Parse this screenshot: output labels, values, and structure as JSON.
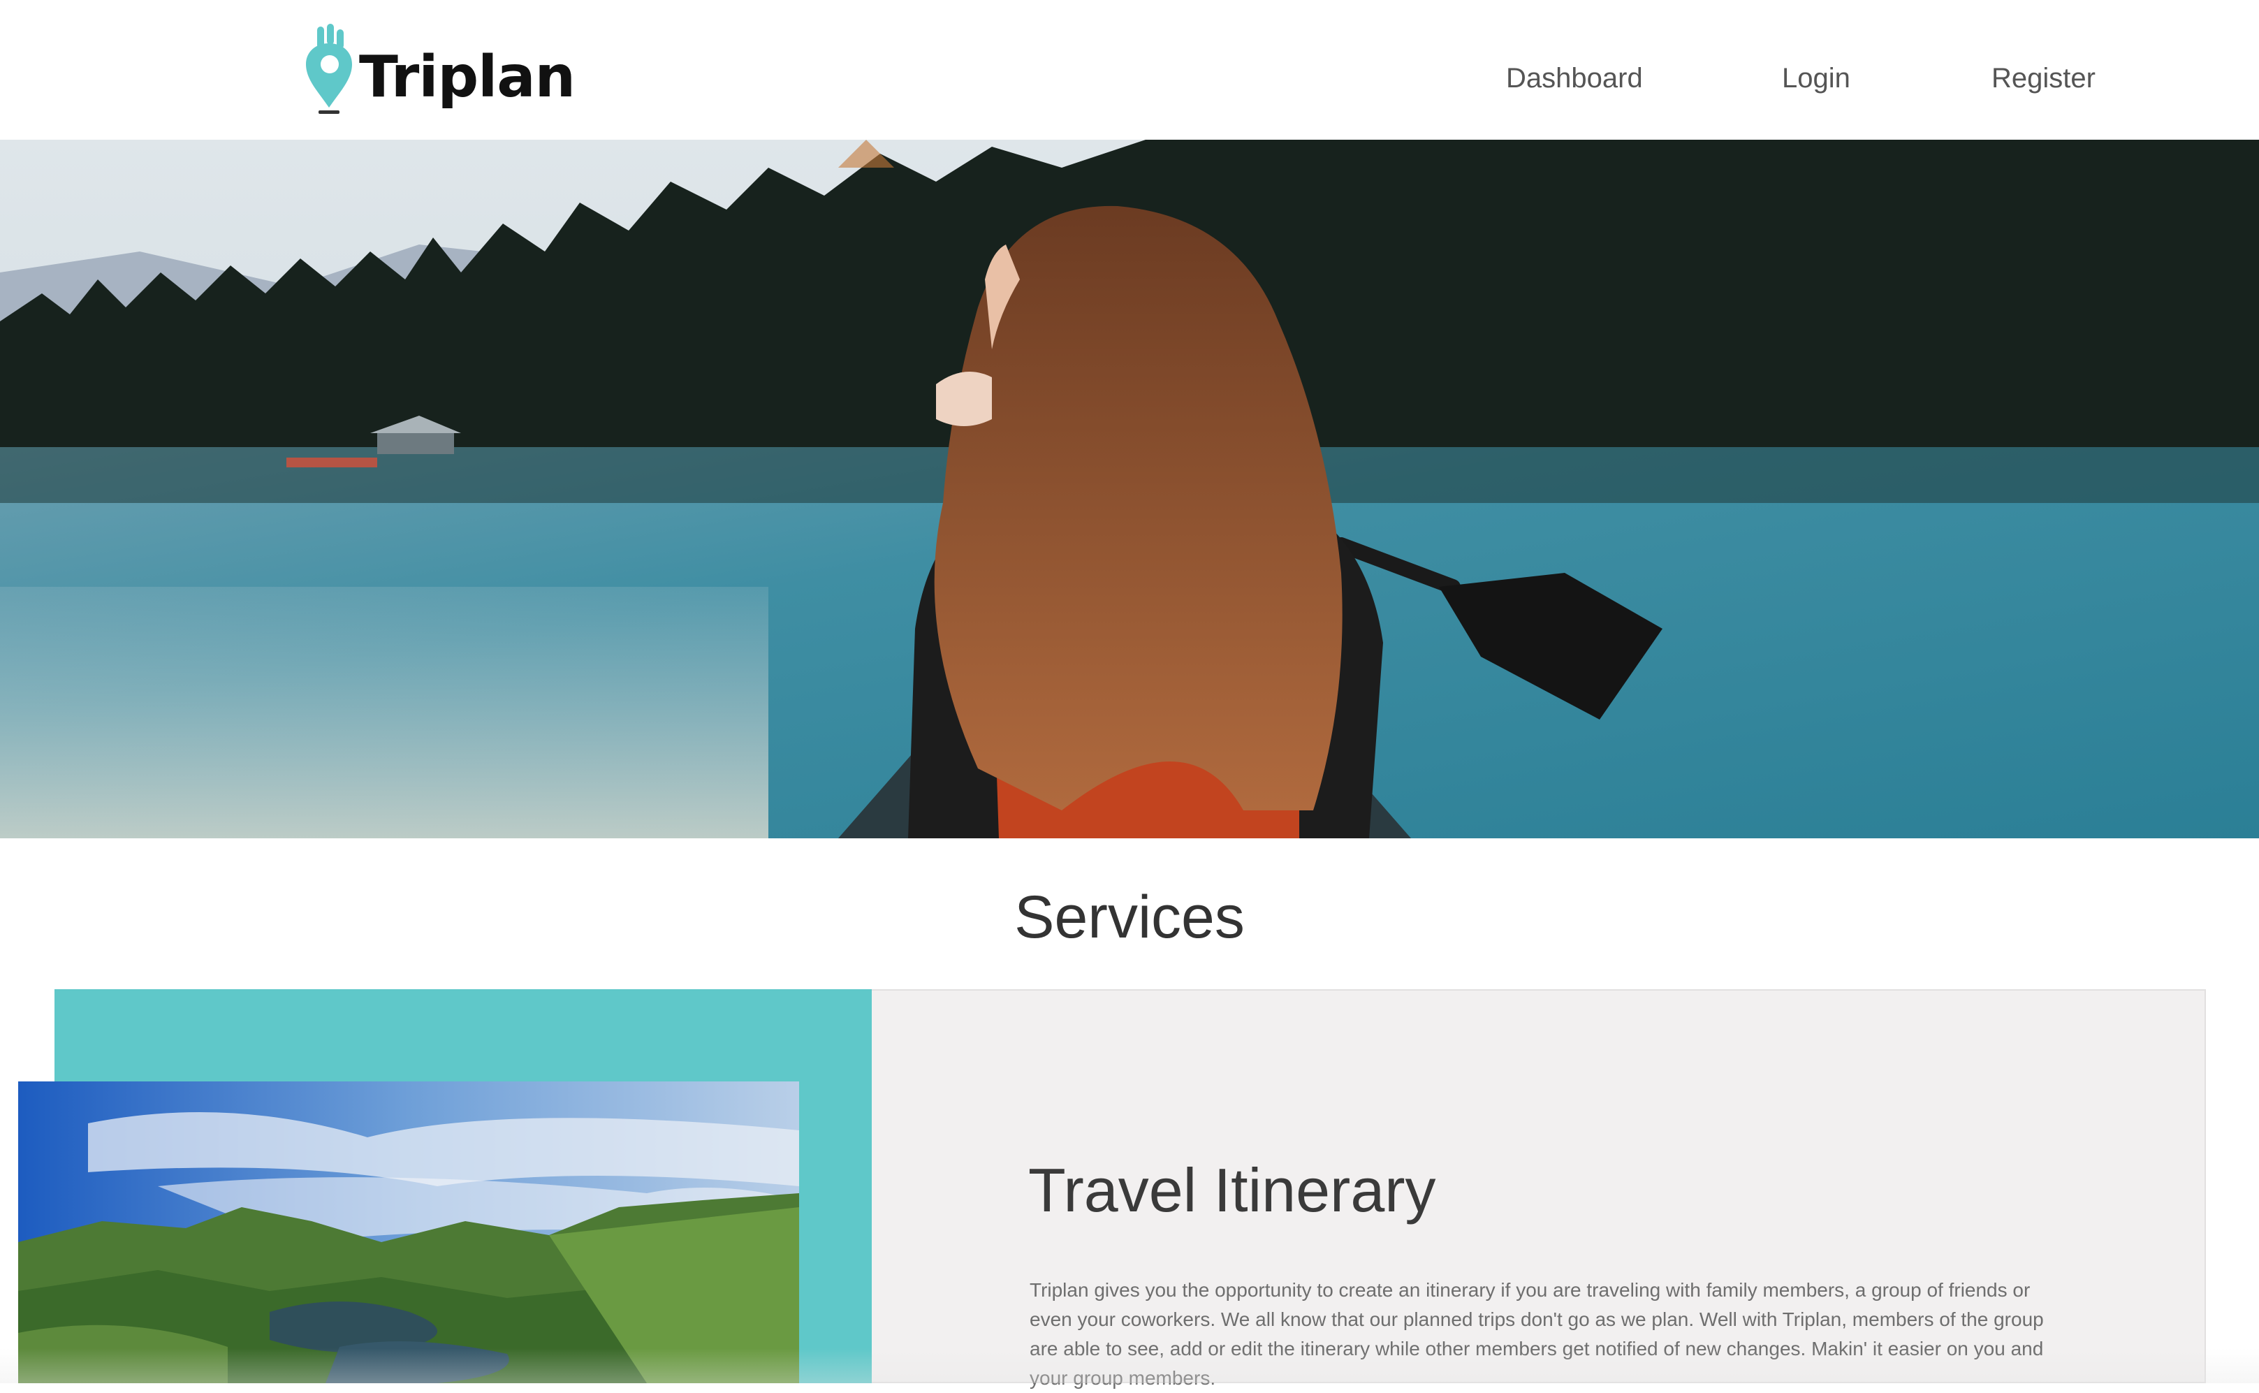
{
  "header": {
    "logo_text": "Triplan",
    "nav": [
      {
        "label": "Dashboard"
      },
      {
        "label": "Login"
      },
      {
        "label": "Register"
      }
    ]
  },
  "colors": {
    "brand_teal": "#5fc8c9",
    "card_bg": "#f2f0f0",
    "heading": "#333333"
  },
  "services": {
    "title": "Services",
    "card": {
      "title": "Travel Itinerary",
      "description": "Triplan gives you the opportunity to create an itinerary if you are traveling with family members, a group of friends or even your coworkers. We all know that our planned trips don't go as we plan. Well with Triplan, members of the group are able to see, add or edit the itinerary while other members get notified of new changes. Makin' it easier on you and your group members."
    }
  }
}
